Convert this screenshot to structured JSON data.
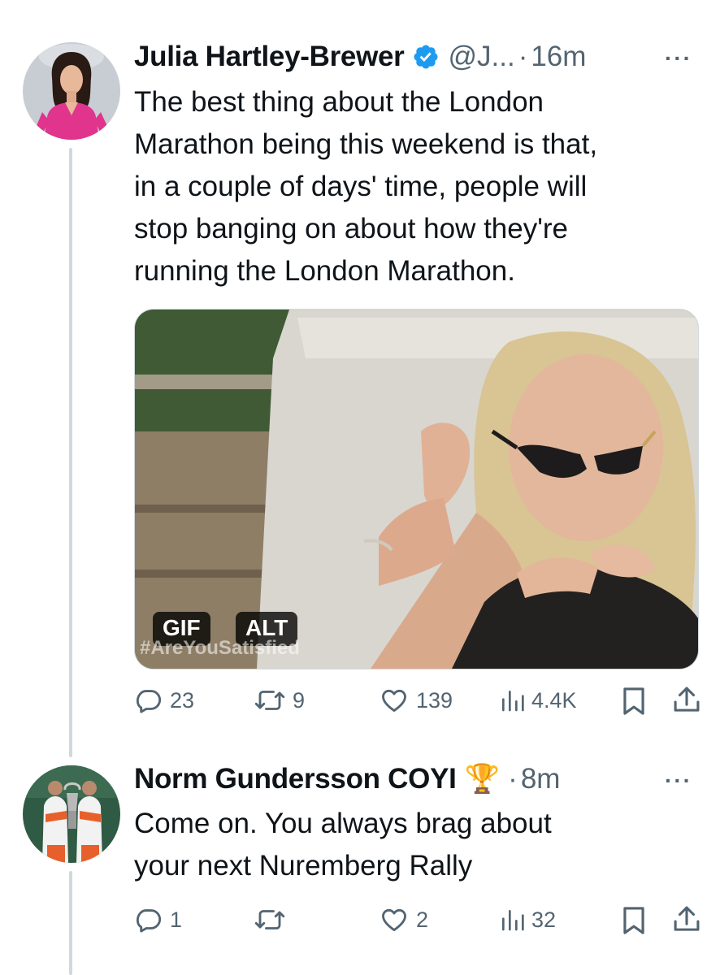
{
  "tweet1": {
    "name": "Julia Hartley-Brewer",
    "handle": "@J...",
    "separator": "·",
    "time": "16m",
    "text_lines": [
      "The best thing about the London",
      "Marathon being this weekend is that,",
      "in a couple of days' time, people will",
      "stop banging on about how they're",
      "running the London Marathon."
    ],
    "media": {
      "gif_badge": "GIF",
      "alt_badge": "ALT",
      "watermark": "#AreYouSatisfied"
    },
    "actions": {
      "replies": "23",
      "reposts": "9",
      "likes": "139",
      "views": "4.4K"
    }
  },
  "tweet2": {
    "name": "Norm Gundersson COYI",
    "name_emoji": "🏆",
    "separator": "·",
    "time": "8m",
    "text_lines": [
      "Come on. You always brag about",
      "your next Nuremberg Rally"
    ],
    "actions": {
      "replies": "1",
      "reposts": "",
      "likes": "2",
      "views": "32"
    }
  },
  "more_label": "···",
  "colors": {
    "text": "#0f1419",
    "secondary": "#536471",
    "verified": "#1d9bf0",
    "thread_line": "#cfd9de"
  }
}
